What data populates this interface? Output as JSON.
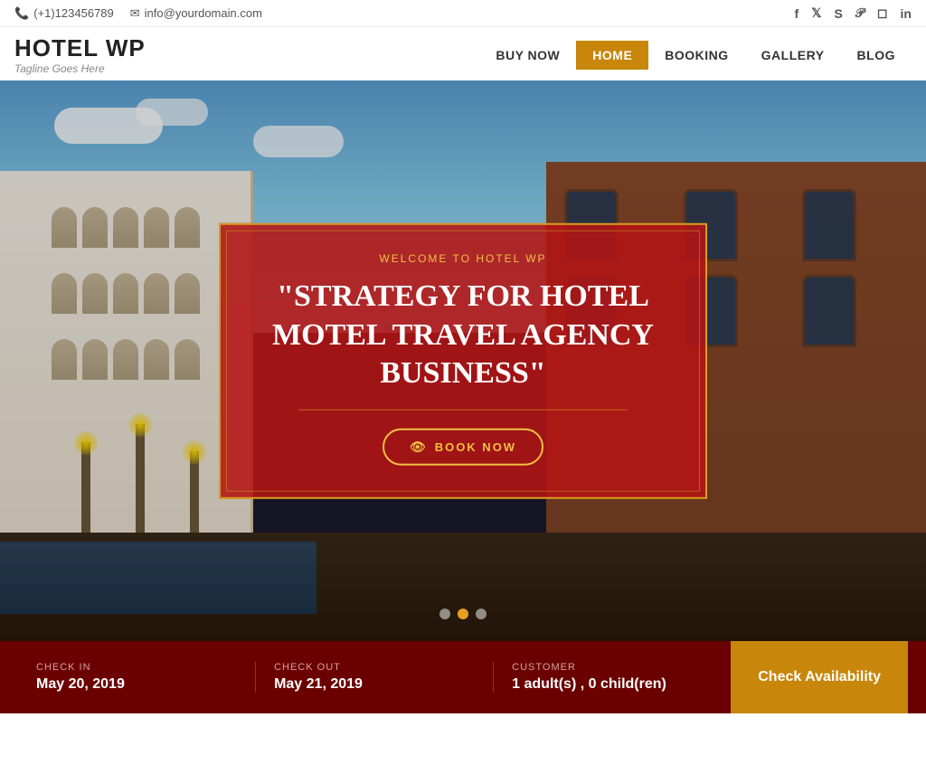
{
  "topbar": {
    "phone": "(+1)123456789",
    "email": "info@yourdomain.com",
    "phone_icon": "📞",
    "email_icon": "✉",
    "socials": [
      {
        "name": "facebook",
        "icon": "f"
      },
      {
        "name": "twitter",
        "icon": "t"
      },
      {
        "name": "skype",
        "icon": "s"
      },
      {
        "name": "pinterest",
        "icon": "p"
      },
      {
        "name": "instagram",
        "icon": "i"
      },
      {
        "name": "linkedin",
        "icon": "in"
      }
    ]
  },
  "header": {
    "logo_title": "HOTEL WP",
    "logo_tagline": "Tagline Goes Here",
    "nav": [
      {
        "label": "BUY NOW",
        "active": false
      },
      {
        "label": "HOME",
        "active": true
      },
      {
        "label": "BOOKING",
        "active": false
      },
      {
        "label": "GALLERY",
        "active": false
      },
      {
        "label": "BLOG",
        "active": false
      }
    ]
  },
  "hero": {
    "subtitle": "WELCOME TO HOTEL WP",
    "title": "\"STRATEGY FOR HOTEL MOTEL TRAVEL AGENCY BUSINESS\"",
    "book_now": "BOOK NOW",
    "dots": [
      {
        "active": false
      },
      {
        "active": true
      },
      {
        "active": false
      }
    ]
  },
  "booking": {
    "checkin_label": "CHECK IN",
    "checkin_value": "May 20, 2019",
    "checkout_label": "CHECK OUT",
    "checkout_value": "May 21, 2019",
    "customer_label": "CUSTOMER",
    "customer_value": "1 adult(s) , 0 child(ren)",
    "cta_label": "Check Availability"
  }
}
